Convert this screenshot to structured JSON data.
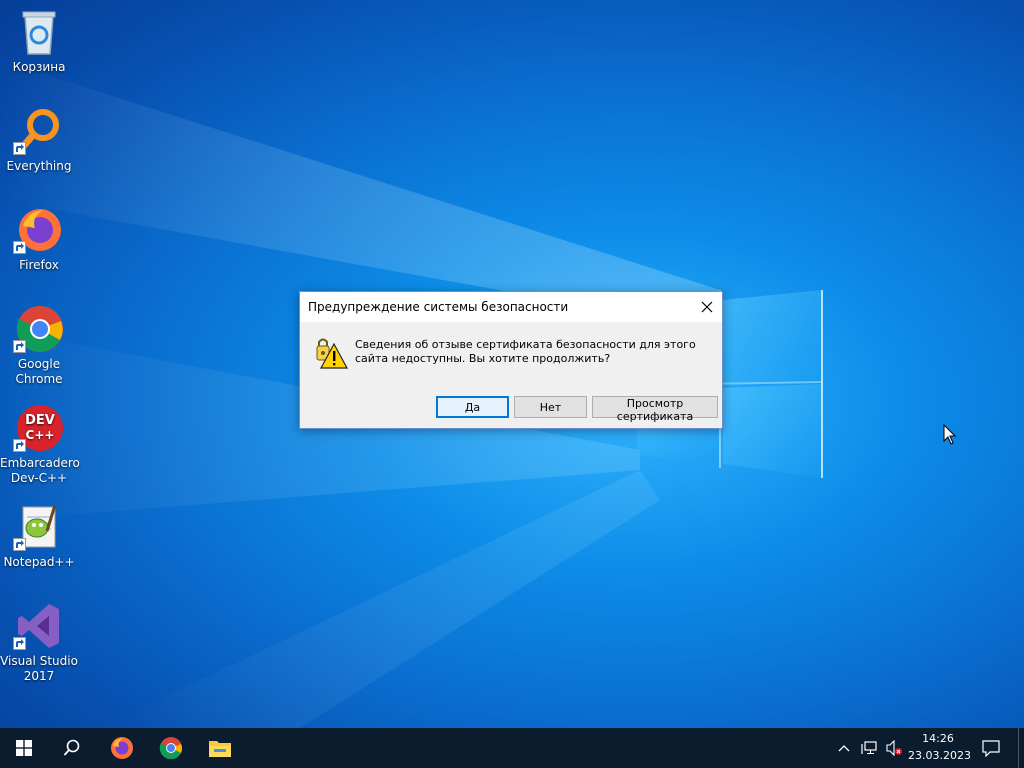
{
  "desktop": {
    "icons": [
      {
        "label": "Корзина",
        "icon": "recycle-bin-icon"
      },
      {
        "label": "Everything",
        "icon": "everything-search-icon"
      },
      {
        "label": "Firefox",
        "icon": "firefox-icon"
      },
      {
        "label": "Google Chrome",
        "icon": "chrome-icon"
      },
      {
        "label": "Embarcadero Dev-C++",
        "icon": "devcpp-icon"
      },
      {
        "label": "Notepad++",
        "icon": "notepadpp-icon"
      },
      {
        "label": "Visual Studio 2017",
        "icon": "visual-studio-icon"
      }
    ]
  },
  "dialog": {
    "title": "Предупреждение системы безопасности",
    "message": "Сведения об отзыве сертификата безопасности для этого сайта недоступны. Вы хотите продолжить?",
    "buttons": {
      "yes": "Да",
      "no": "Нет",
      "view_cert": "Просмотр сертификата"
    }
  },
  "taskbar": {
    "apps": [
      "start-icon",
      "search-icon",
      "firefox-icon",
      "chrome-icon",
      "file-explorer-icon"
    ],
    "tray": {
      "time": "14:26",
      "date": "23.03.2023"
    }
  },
  "colors": {
    "accent": "#0078d7",
    "taskbar": "#0b1c2f"
  }
}
